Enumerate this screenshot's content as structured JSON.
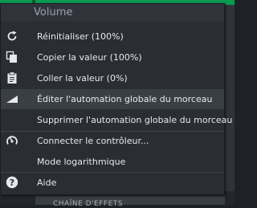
{
  "background": {
    "bottom_label": "CHAÎNE D'EFFETS"
  },
  "menu": {
    "title": "Volume",
    "items": [
      {
        "label": "Réinitialiser (100%)",
        "icon": "reload-icon"
      },
      {
        "label": "Copier la valeur (100%)",
        "icon": "copy-icon"
      },
      {
        "label": "Coller la valeur (0%)",
        "icon": "paste-icon"
      },
      {
        "label": "Éditer l'automation globale du morceau",
        "icon": "automation-ramp-icon"
      },
      {
        "label": "Supprimer l'automation globale du morceau",
        "icon": ""
      },
      {
        "label": "Connecter le contrôleur...",
        "icon": "controller-knob-icon"
      },
      {
        "label": "Mode logarithmique",
        "icon": ""
      },
      {
        "label": "Aide",
        "icon": "help-icon"
      }
    ]
  },
  "colors": {
    "menu_bg": "#2a2d33",
    "text": "#e6e8eb",
    "title_text": "#9aa0a8",
    "highlight": "#3a3f46",
    "accent_green": "#0a9a52"
  }
}
